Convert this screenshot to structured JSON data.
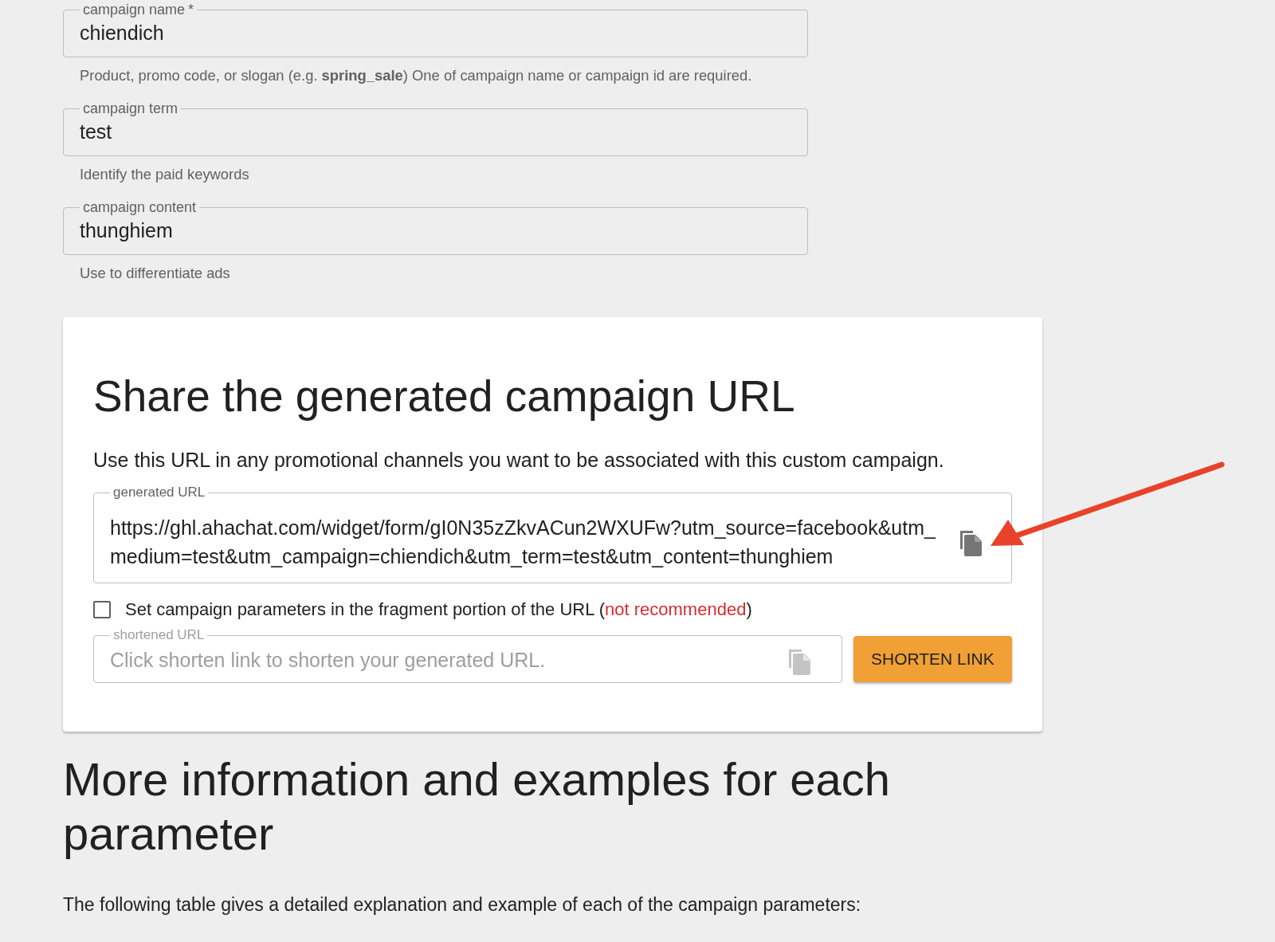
{
  "fields": [
    {
      "label": "campaign name",
      "required_mark": "*",
      "value": "chiendich",
      "helper": "Product, promo code, or slogan (e.g. **spring_sale**) One of campaign name or campaign id are required."
    },
    {
      "label": "campaign term",
      "value": "test",
      "helper": "Identify the paid keywords"
    },
    {
      "label": "campaign content",
      "value": "thunghiem",
      "helper": "Use to differentiate ads"
    }
  ],
  "share_card": {
    "title": "Share the generated campaign URL",
    "description": "Use this URL in any promotional channels you want to be associated with this custom campaign.",
    "generated_url": {
      "label": "generated URL",
      "value": "https://ghl.ahachat.com/widget/form/gI0N35zZkvACun2WXUFw?utm_source=facebook&utm_medium=test&utm_campaign=chiendich&utm_term=test&utm_content=thunghiem",
      "copy_disabled": false
    },
    "fragment_option": {
      "label": "Set campaign parameters in the fragment portion of the URL (",
      "warning": "not recommended",
      "label_end": ")",
      "checked": false
    },
    "shortened_url": {
      "label": "shortened URL",
      "placeholder": "Click shorten link to shorten your generated URL.",
      "copy_disabled": true
    },
    "shorten_button": "SHORTEN LINK"
  },
  "info": {
    "title": "More information and examples for each parameter",
    "description": "The following table gives a detailed explanation and example of each of the campaign parameters:"
  }
}
